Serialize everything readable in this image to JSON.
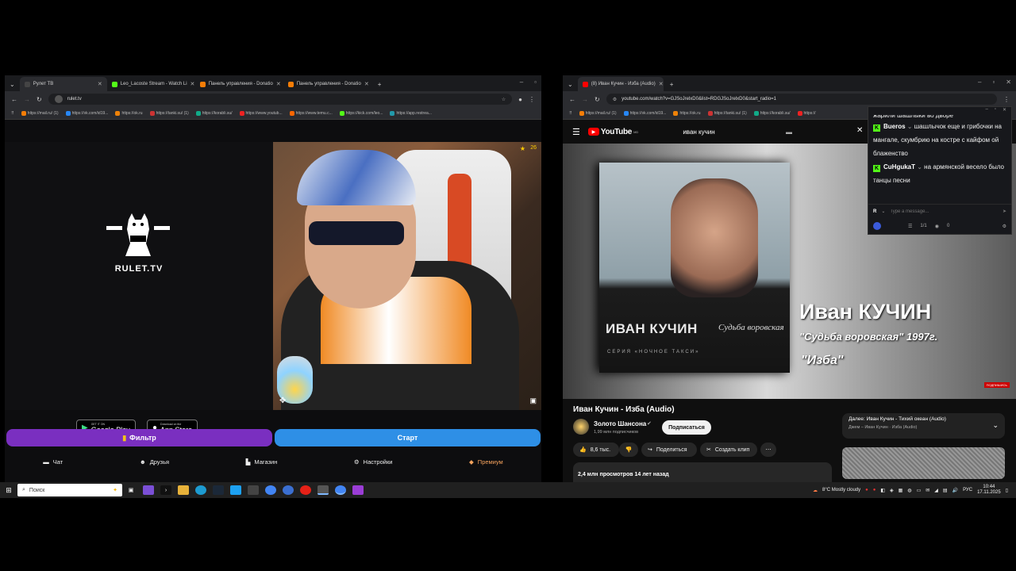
{
  "left_browser": {
    "tabs": [
      {
        "title": "Рулет ТВ",
        "active": true
      },
      {
        "title": "Leo_Lacoste Stream - Watch Li",
        "active": false
      },
      {
        "title": "Панель управления - Donatio",
        "active": false
      },
      {
        "title": "Панель управления - Donatio",
        "active": false
      }
    ],
    "url": "rulet.tv",
    "bookmarks": [
      "https://mail.ru/ (1)",
      "https://vk.com/id19...",
      "https://ok.ru",
      "https://tanki.su/ (1)",
      "https://korabli.su/",
      "https://www.youtub...",
      "https://www.temu.c...",
      "https://kick.com/leo...",
      "https://app.restrea..."
    ],
    "brand": "RULET.TV",
    "google_play": {
      "small": "GET IT ON",
      "big": "Google Play"
    },
    "app_store": {
      "small": "Download on the",
      "big": "App Store"
    },
    "viewer_count": "26",
    "filter_button": "Фильтр",
    "start_button": "Старт",
    "nav": [
      {
        "label": "Чат",
        "icon": "chat-icon"
      },
      {
        "label": "Друзья",
        "icon": "friends-icon"
      },
      {
        "label": "Магазин",
        "icon": "shop-icon"
      },
      {
        "label": "Настройки",
        "icon": "gear-icon"
      },
      {
        "label": "Премиум",
        "icon": "premium-icon"
      }
    ]
  },
  "right_browser": {
    "tabs": [
      {
        "title": "(8) Иван Кучин - Изба (Audio)",
        "active": true
      }
    ],
    "url": "youtube.com/watch?v=GJSoJrelxD0&list=RDGJSoJrelxD0&start_radio=1",
    "bookmarks": [
      "https://mail.ru/ (1)",
      "https://vk.com/id19...",
      "https://ok.ru",
      "https://tanki.su/ (1)",
      "https://korabli.su/",
      "https://"
    ],
    "youtube": {
      "logo_text": "YouTube",
      "logo_sup": "MD",
      "search_query": "иван кучин",
      "album_cover_text": "ИВАН КУЧИН",
      "album_cover_script": "Судьба воровская",
      "album_cover_series": "СЕРИЯ «НОЧНОЕ ТАКСИ»",
      "overlay_name": "Иван КУЧИН",
      "overlay_album": "\"Судьба воровская\" 1997г.",
      "overlay_song": "\"Изба\"",
      "subscribe_watermark": "ПОДПИШИСЬ",
      "video_title": "Иван Кучин - Изба (Audio)",
      "channel_name": "Золото Шансона",
      "subscribers": "1,99 млн подписчиков",
      "subscribe_label": "Подписаться",
      "likes": "8,6 тыс.",
      "share_label": "Поделиться",
      "clip_label": "Создать клип",
      "views_line": "2,4 млн просмотров  14 лет назад",
      "next_title": "Далее: Иван Кучин - Тихий океан (Audio)",
      "next_sub": "Джем – Иван Кучин · Изба (Audio)"
    }
  },
  "chat_overlay": {
    "top_message": "жарили шашлыки во дворе",
    "messages": [
      {
        "user": "Bueros",
        "text": "шашлычок еще и грибочки на мангале, скумбрию на костре с кайфом ой блаженство"
      },
      {
        "user": "CuHgukaT",
        "text": "на армянской весело было танцы песни"
      }
    ],
    "input_placeholder": "Type a message...",
    "stat_1": "1/1",
    "stat_2": "0"
  },
  "taskbar": {
    "search_placeholder": "Поиск",
    "weather": "8°C  Mostly cloudy",
    "lang": "РУС",
    "time": "10:44",
    "date": "17.11.2025"
  }
}
